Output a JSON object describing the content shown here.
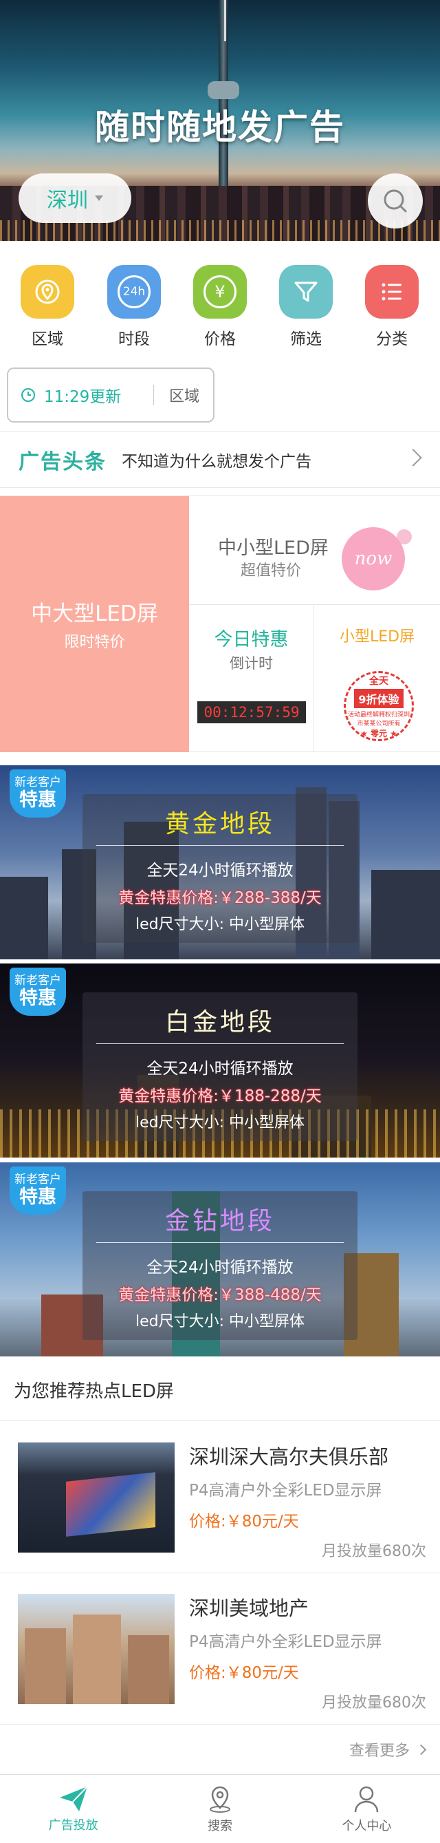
{
  "hero": {
    "title": "随时随地发广告",
    "city": "深圳"
  },
  "categories": [
    {
      "label": "区域",
      "color": "#f6c53b",
      "icon": "location-icon"
    },
    {
      "label": "时段",
      "color": "#5aa0e8",
      "icon": "clock-24h-icon",
      "icon_text": "24h"
    },
    {
      "label": "价格",
      "color": "#8cc63f",
      "icon": "yen-icon",
      "icon_text": "¥"
    },
    {
      "label": "筛选",
      "color": "#6cc3c8",
      "icon": "filter-icon"
    },
    {
      "label": "分类",
      "color": "#f06766",
      "icon": "list-icon"
    }
  ],
  "filter": {
    "time": "11:29更新",
    "area": "区域"
  },
  "headline": {
    "tag": "广告头条",
    "text": "不知道为什么就想发个广告"
  },
  "promo": {
    "big_title": "中大型LED屏",
    "big_sub": "限时特价",
    "mid_title": "中小型LED屏",
    "mid_sub": "超值特价",
    "now": "now",
    "today_title": "今日特惠",
    "today_sub": "倒计时",
    "countdown": "00:12:57:59",
    "small_title": "小型LED屏",
    "stamp": {
      "a": "全天",
      "b": "9折体验",
      "c": "活动最终解释权归深圳市某某公司所有",
      "d": "★ 零元 ★"
    }
  },
  "banners": [
    {
      "badge_top": "新老客户",
      "badge_main": "特惠",
      "title": "黄金地段",
      "title_color": "#f8e51c",
      "line1": "全天24小时循环播放",
      "line2": "黄金特惠价格:￥288-388/天",
      "line3": "led尺寸大小:  中小型屏体"
    },
    {
      "badge_top": "新老客户",
      "badge_main": "特惠",
      "title": "白金地段",
      "title_color": "#fff7d0",
      "line1": "全天24小时循环播放",
      "line2": "黄金特惠价格:￥188-288/天",
      "line3": "led尺寸大小:  中小型屏体"
    },
    {
      "badge_top": "新老客户",
      "badge_main": "特惠",
      "title": "金钻地段",
      "title_color": "#d98cff",
      "line1": "全天24小时循环播放",
      "line2": "黄金特惠价格:￥388-488/天",
      "line3": "led尺寸大小:  中小型屏体"
    }
  ],
  "recommend": {
    "title": "为您推荐热点LED屏",
    "items": [
      {
        "name": "深圳深大高尔夫俱乐部",
        "desc": "P4高清户外全彩LED显示屏",
        "price": "价格:￥80元/天",
        "volume": "月投放量680次"
      },
      {
        "name": "深圳美域地产",
        "desc": "P4高清户外全彩LED显示屏",
        "price": "价格:￥80元/天",
        "volume": "月投放量680次"
      }
    ],
    "more": "查看更多"
  },
  "tabs": [
    {
      "label": "广告投放",
      "icon": "paper-plane-icon",
      "active": true
    },
    {
      "label": "搜索",
      "icon": "map-pin-icon",
      "active": false
    },
    {
      "label": "个人中心",
      "icon": "person-icon",
      "active": false
    }
  ],
  "colors": {
    "accent": "#28b7a3",
    "orange": "#f2711c",
    "promo_pink": "#fbaea0"
  }
}
